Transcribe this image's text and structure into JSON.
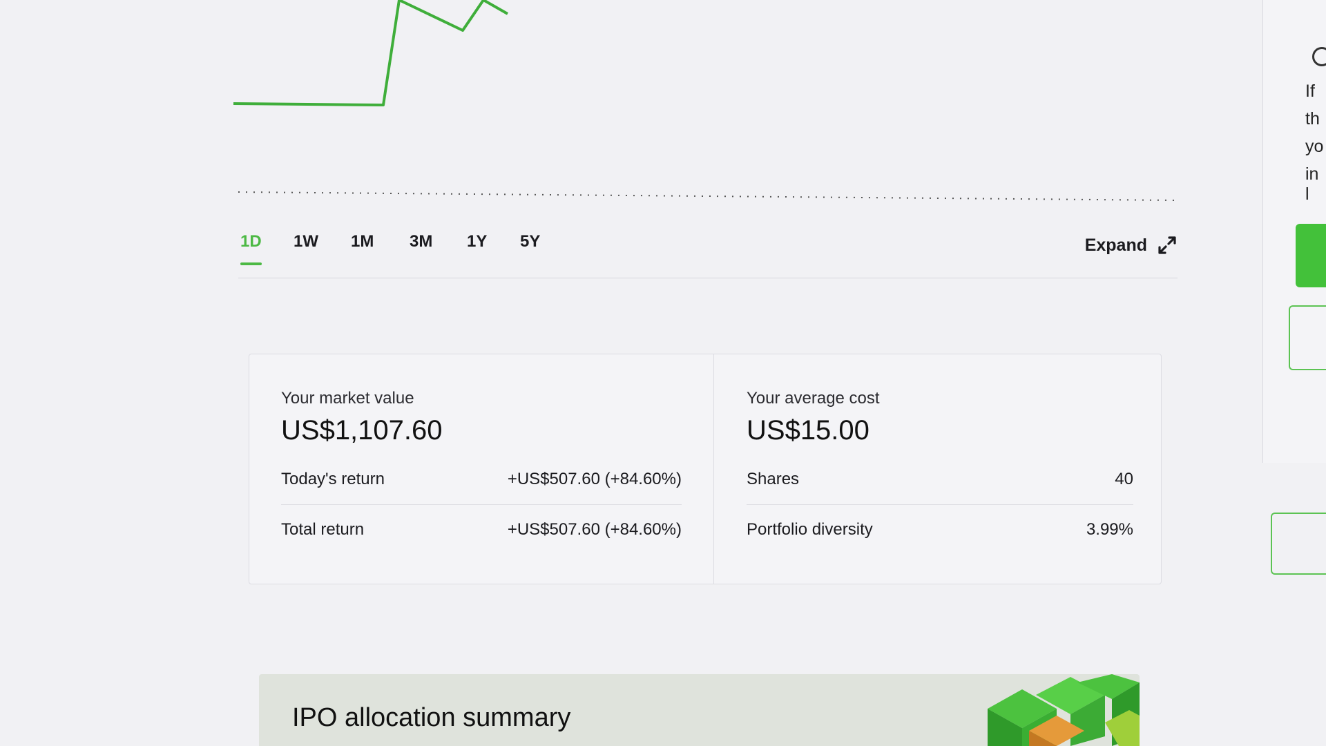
{
  "timeframes": {
    "tab_1d": "1D",
    "tab_1w": "1W",
    "tab_1m": "1M",
    "tab_3m": "3M",
    "tab_1y": "1Y",
    "tab_5y": "5Y",
    "active": "1D"
  },
  "expand_label": "Expand",
  "stats": {
    "market_value_label": "Your market value",
    "market_value": "US$1,107.60",
    "todays_return_label": "Today's return",
    "todays_return": "+US$507.60 (+84.60%)",
    "total_return_label": "Total return",
    "total_return": "+US$507.60 (+84.60%)",
    "average_cost_label": "Your average cost",
    "average_cost": "US$15.00",
    "shares_label": "Shares",
    "shares": "40",
    "portfolio_diversity_label": "Portfolio diversity",
    "portfolio_diversity": "3.99%"
  },
  "side_panel": {
    "line1": "If",
    "line2": "th",
    "line3": "yo",
    "line4": "in l"
  },
  "ipo_banner": {
    "title": "IPO allocation summary"
  },
  "colors": {
    "accent_green": "#4cb944",
    "price_line": "#3fae3a"
  }
}
